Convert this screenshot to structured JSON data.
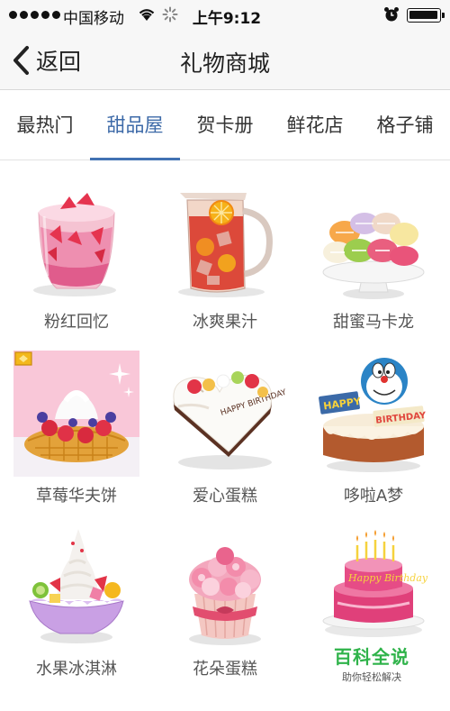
{
  "status_bar": {
    "carrier": "中国移动",
    "time": "上午9:12"
  },
  "nav": {
    "back_label": "返回",
    "title": "礼物商城"
  },
  "tabs": [
    {
      "label": "最热门",
      "active": false
    },
    {
      "label": "甜品屋",
      "active": true
    },
    {
      "label": "贺卡册",
      "active": false
    },
    {
      "label": "鲜花店",
      "active": false
    },
    {
      "label": "格子铺",
      "active": false
    }
  ],
  "gifts": [
    {
      "name": "粉红回忆",
      "icon": "strawberry-parfait-icon"
    },
    {
      "name": "冰爽果汁",
      "icon": "fruit-juice-pitcher-icon"
    },
    {
      "name": "甜蜜马卡龙",
      "icon": "macaron-plate-icon"
    },
    {
      "name": "草莓华夫饼",
      "icon": "strawberry-waffle-icon"
    },
    {
      "name": "爱心蛋糕",
      "icon": "heart-cake-icon"
    },
    {
      "name": "哆啦A梦",
      "icon": "doraemon-cake-icon"
    },
    {
      "name": "水果冰淇淋",
      "icon": "fruit-ice-cream-icon"
    },
    {
      "name": "花朵蛋糕",
      "icon": "flower-cupcake-icon"
    },
    {
      "name": "",
      "icon": "birthday-cake-icon"
    }
  ],
  "watermark": {
    "title": "百科全说",
    "subtitle": "助你轻松解决"
  },
  "colors": {
    "accent": "#4272b3",
    "watermark_green": "#2fb34a"
  }
}
